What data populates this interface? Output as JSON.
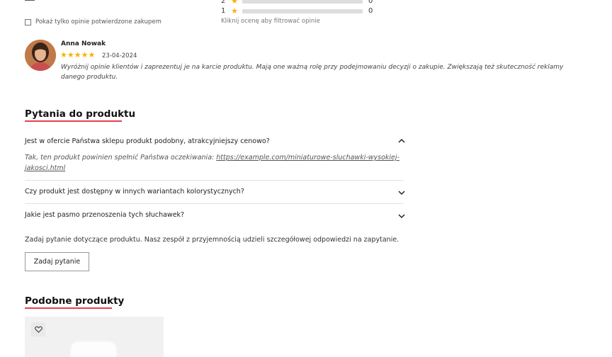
{
  "ratings": {
    "rows": [
      {
        "stars": "2",
        "count": "0"
      },
      {
        "stars": "1",
        "count": "0"
      }
    ],
    "filter_hint": "Kliknij ocenę aby filtrować opinie",
    "verified_only_label": "Pokaż tylko opinie potwierdzone zakupem",
    "star_color": "#f5b400"
  },
  "review": {
    "author": "Anna Nowak",
    "stars": "★★★★★",
    "date": "23-04-2024",
    "text": "Wyróżnij opinie klientów i zaprezentuj je na karcie produktu. Mają one ważną rolę przy podejmowaniu decyzji o zakupie. Zwiększają też skuteczność reklamy danego produktu."
  },
  "questions": {
    "title": "Pytania do produktu",
    "items": [
      {
        "question": "Jest w ofercie Państwa sklepu produkt podobny, atrakcyjniejszy cenowo?",
        "answer_prefix": "Tak, ten produkt powinien spełnić Państwa oczekiwania: ",
        "answer_link": "https://example.com/miniaturowe-sluchawki-wysokiej-jakosci.html",
        "expanded": true
      },
      {
        "question": "Czy produkt jest dostępny w innych wariantach kolorystycznych?",
        "expanded": false
      },
      {
        "question": "Jakie jest pasmo przenoszenia tych słuchawek?",
        "expanded": false
      }
    ],
    "ask_text": "Zadaj pytanie dotyczące produktu. Nasz zespół z przyjemnością udzieli szczegółowej odpowiedzi na zapytanie.",
    "ask_button": "Zadaj pytanie"
  },
  "similar": {
    "title": "Podobne produkty"
  },
  "colors": {
    "accent_underline": "#e8404e"
  }
}
